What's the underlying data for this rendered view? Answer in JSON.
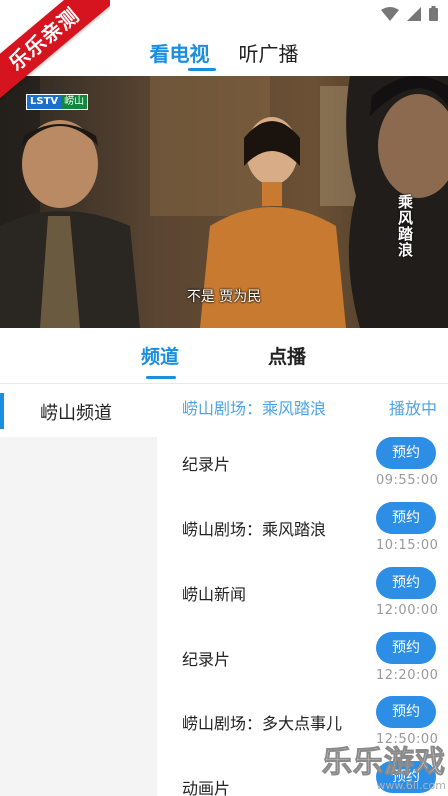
{
  "badge": {
    "text": "乐乐亲测"
  },
  "top_tabs": [
    {
      "label": "看电视",
      "active": true
    },
    {
      "label": "听广播",
      "active": false
    }
  ],
  "video": {
    "logo_left": "LSTV",
    "logo_right": "崂山",
    "subtitle": "不是 贾为民",
    "vertical_title": "乘风踏浪"
  },
  "sub_tabs": [
    {
      "label": "频道",
      "active": true
    },
    {
      "label": "点播",
      "active": false
    }
  ],
  "sidebar": {
    "items": [
      {
        "label": "崂山频道",
        "active": true
      }
    ]
  },
  "now_playing": {
    "title": "崂山剧场：乘风踏浪",
    "status": "播放中"
  },
  "programs": [
    {
      "title": "纪录片",
      "button": "预约",
      "time": "09:55:00"
    },
    {
      "title": "崂山剧场：乘风踏浪",
      "button": "预约",
      "time": "10:15:00"
    },
    {
      "title": "崂山新闻",
      "button": "预约",
      "time": "12:00:00"
    },
    {
      "title": "纪录片",
      "button": "预约",
      "time": "12:20:00"
    },
    {
      "title": "崂山剧场：多大点事儿",
      "button": "预约",
      "time": "12:50:00"
    },
    {
      "title": "动画片",
      "button": "预约",
      "time": ""
    }
  ],
  "watermark": {
    "main": "乐乐游戏",
    "url": "www.6ll.com"
  },
  "colors": {
    "accent": "#1a8fe0",
    "button": "#2d8ee6",
    "ribbon": "#d6141f"
  }
}
